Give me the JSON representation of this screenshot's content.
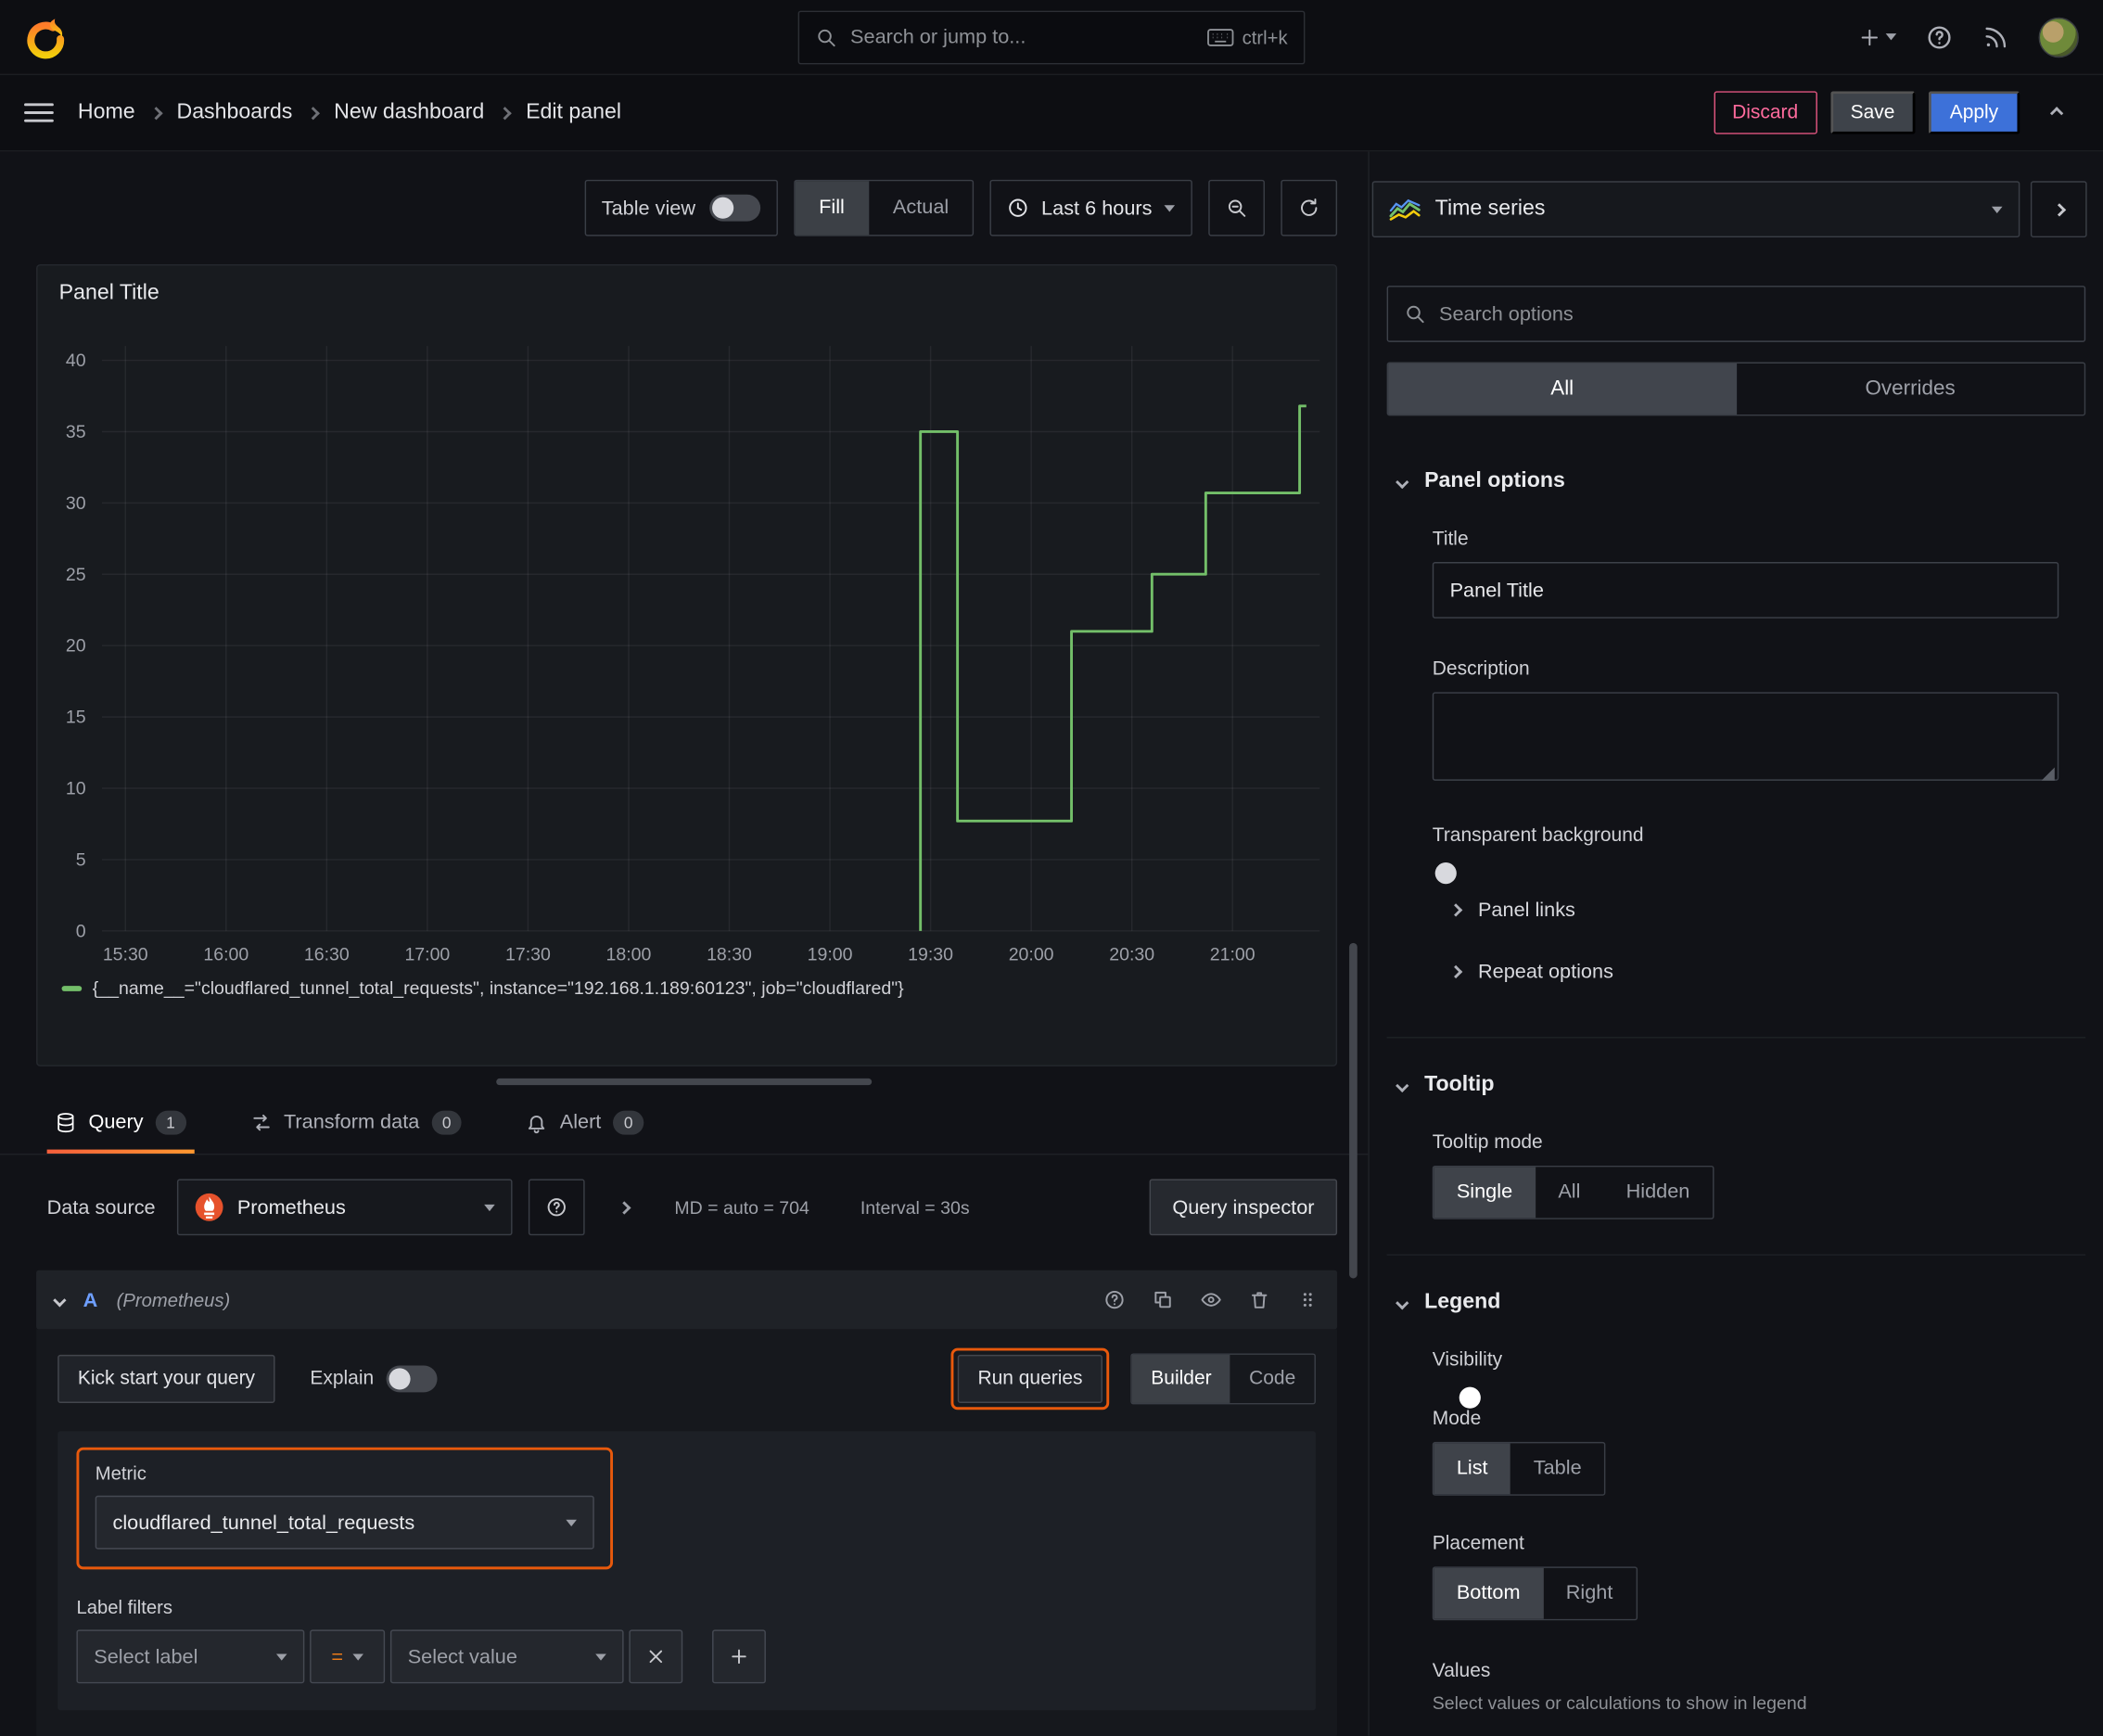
{
  "colors": {
    "accent_blue": "#3d71d9",
    "highlight_orange": "#e8590c",
    "series_green": "#73bf69",
    "discard_pink": "#ff6b9d"
  },
  "topbar": {
    "search_placeholder": "Search or jump to...",
    "search_shortcut": "ctrl+k"
  },
  "nav": {
    "breadcrumb": [
      "Home",
      "Dashboards",
      "New dashboard",
      "Edit panel"
    ],
    "discard": "Discard",
    "save": "Save",
    "apply": "Apply"
  },
  "panel_toolbar": {
    "table_view": "Table view",
    "fill": "Fill",
    "actual": "Actual",
    "time_range": "Last 6 hours"
  },
  "panel": {
    "title": "Panel Title"
  },
  "chart_data": {
    "type": "line",
    "step": true,
    "title": "Panel Title",
    "line_color": "#73bf69",
    "grid": true,
    "legend_position": "bottom",
    "x_ticks": [
      "15:30",
      "16:00",
      "16:30",
      "17:00",
      "17:30",
      "18:00",
      "18:30",
      "19:00",
      "19:30",
      "20:00",
      "20:30",
      "21:00"
    ],
    "x_tick_interval_minutes": 30,
    "x_range_minutes": [
      -7,
      356
    ],
    "y_ticks": [
      0,
      5,
      10,
      15,
      20,
      25,
      30,
      35,
      40
    ],
    "ylim": [
      0,
      41
    ],
    "series": [
      {
        "name": "{__name__=\"cloudflared_tunnel_total_requests\", instance=\"192.168.1.189:60123\", job=\"cloudflared\"}",
        "color": "#73bf69",
        "points_minutes_value": [
          [
            237,
            0
          ],
          [
            237,
            35
          ],
          [
            248,
            35
          ],
          [
            248,
            7.7
          ],
          [
            282,
            7.7
          ],
          [
            282,
            21
          ],
          [
            306,
            21
          ],
          [
            306,
            25
          ],
          [
            322,
            25
          ],
          [
            322,
            30.7
          ],
          [
            350,
            30.7
          ],
          [
            350,
            36.8
          ],
          [
            352,
            36.8
          ]
        ]
      }
    ]
  },
  "editor_tabs": {
    "query": "Query",
    "query_badge": "1",
    "transform": "Transform data",
    "transform_badge": "0",
    "alert": "Alert",
    "alert_badge": "0"
  },
  "query": {
    "datasource_label": "Data source",
    "datasource_name": "Prometheus",
    "max_data_points": "MD = auto = 704",
    "interval": "Interval = 30s",
    "inspector": "Query inspector",
    "ref_id": "A",
    "ref_ds": "(Prometheus)",
    "kick_start": "Kick start your query",
    "explain": "Explain",
    "run_queries": "Run queries",
    "builder": "Builder",
    "code": "Code",
    "metric_label": "Metric",
    "metric_value": "cloudflared_tunnel_total_requests",
    "label_filters": "Label filters",
    "select_label": "Select label",
    "operator": "=",
    "select_value": "Select value"
  },
  "options": {
    "viz_name": "Time series",
    "search_placeholder": "Search options",
    "tab_all": "All",
    "tab_overrides": "Overrides",
    "panel_options": "Panel options",
    "title_label": "Title",
    "title_value": "Panel Title",
    "description_label": "Description",
    "transparent_bg": "Transparent background",
    "panel_links": "Panel links",
    "repeat_options": "Repeat options",
    "tooltip": "Tooltip",
    "tooltip_mode": "Tooltip mode",
    "tooltip_single": "Single",
    "tooltip_all": "All",
    "tooltip_hidden": "Hidden",
    "legend": "Legend",
    "visibility": "Visibility",
    "mode": "Mode",
    "mode_list": "List",
    "mode_table": "Table",
    "placement": "Placement",
    "placement_bottom": "Bottom",
    "placement_right": "Right",
    "values": "Values",
    "values_help": "Select values or calculations to show in legend"
  }
}
